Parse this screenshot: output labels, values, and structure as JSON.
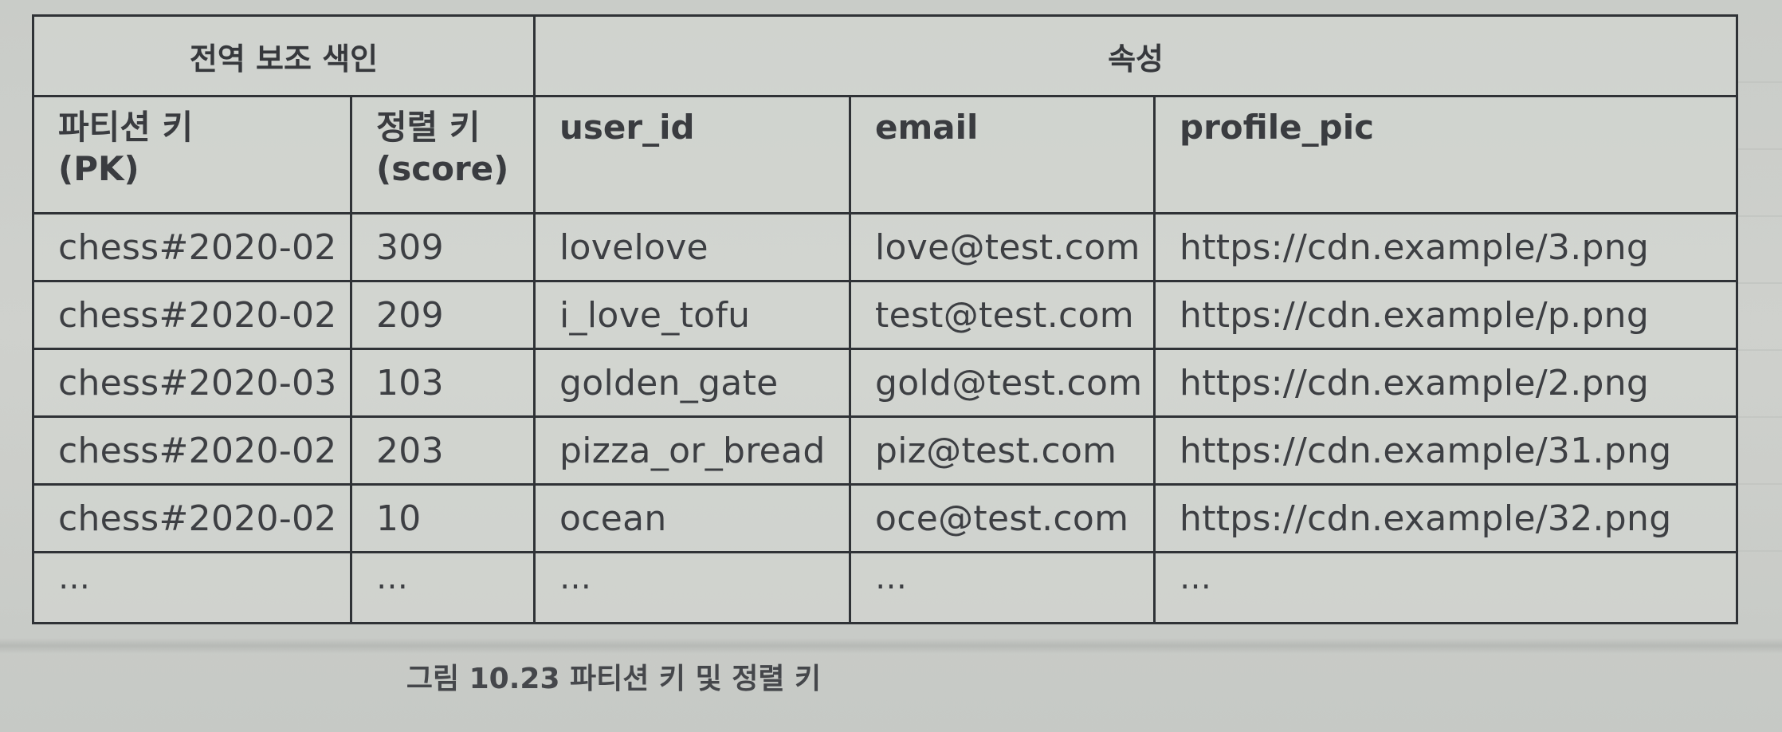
{
  "table": {
    "group_headers": {
      "gsi": "전역 보조 색인",
      "attributes": "속성"
    },
    "columns": [
      {
        "line1": "파티션 키",
        "line2": "(PK)"
      },
      {
        "line1": "정렬 키",
        "line2": "(score)"
      },
      {
        "line1": "user_id",
        "line2": ""
      },
      {
        "line1": "email",
        "line2": ""
      },
      {
        "line1": "profile_pic",
        "line2": ""
      }
    ],
    "rows": [
      [
        "chess#2020-02",
        "309",
        "lovelove",
        "love@test.com",
        "https://cdn.example/3.png"
      ],
      [
        "chess#2020-02",
        "209",
        "i_love_tofu",
        "test@test.com",
        "https://cdn.example/p.png"
      ],
      [
        "chess#2020-03",
        "103",
        "golden_gate",
        "gold@test.com",
        "https://cdn.example/2.png"
      ],
      [
        "chess#2020-02",
        "203",
        "pizza_or_bread",
        "piz@test.com",
        "https://cdn.example/31.png"
      ],
      [
        "chess#2020-02",
        "10",
        "ocean",
        "oce@test.com",
        "https://cdn.example/32.png"
      ],
      [
        "…",
        "…",
        "…",
        "…",
        "…"
      ]
    ]
  },
  "caption": "그림 10.23 파티션 키 및 정렬 키"
}
